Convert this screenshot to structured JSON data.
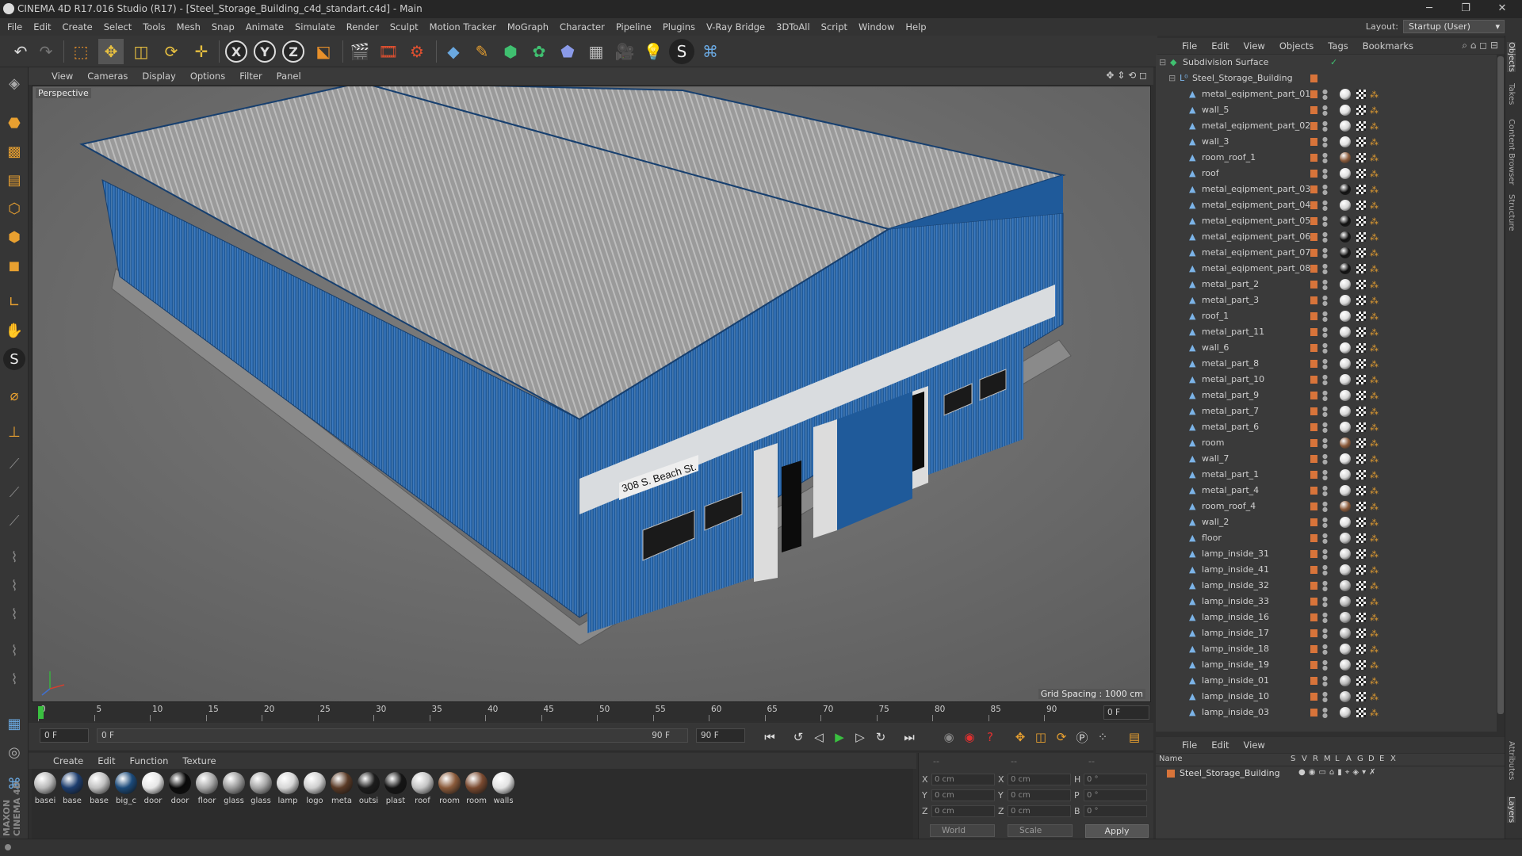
{
  "window": {
    "title": "CINEMA 4D R17.016 Studio (R17) - [Steel_Storage_Building_c4d_standart.c4d] - Main",
    "min": "─",
    "max": "❐",
    "close": "✕"
  },
  "menubar": [
    "File",
    "Edit",
    "Create",
    "Select",
    "Tools",
    "Mesh",
    "Snap",
    "Animate",
    "Simulate",
    "Render",
    "Sculpt",
    "Motion Tracker",
    "MoGraph",
    "Character",
    "Pipeline",
    "Plugins",
    "V-Ray Bridge",
    "3DToA​ll",
    "Script",
    "Window",
    "Help"
  ],
  "layout": {
    "label": "Layout:",
    "value": "Startup (User)"
  },
  "toolbar": {
    "x": "X",
    "y": "Y",
    "z": "Z"
  },
  "viewport": {
    "menu": [
      "View",
      "Cameras",
      "Display",
      "Options",
      "Filter",
      "Panel"
    ],
    "label": "Perspective",
    "grid_spacing": "Grid Spacing : 1000 cm",
    "sign_text": "308 S. Beach St."
  },
  "timeline": {
    "ticks": [
      "0",
      "5",
      "10",
      "15",
      "20",
      "25",
      "30",
      "35",
      "40",
      "45",
      "50",
      "55",
      "60",
      "65",
      "70",
      "75",
      "80",
      "85",
      "90"
    ],
    "end_frame": "0 F"
  },
  "transport": {
    "start": "0 F",
    "slider_start": "0 F",
    "slider_end": "90 F",
    "end": "90 F"
  },
  "materials": {
    "menu": [
      "Create",
      "Edit",
      "Function",
      "Texture"
    ],
    "items": [
      {
        "label": "basei",
        "color": "#b8b8b8"
      },
      {
        "label": "base",
        "color": "#1d3d6e"
      },
      {
        "label": "base",
        "color": "#c0c0c0"
      },
      {
        "label": "big_c",
        "color": "#1b4a7a"
      },
      {
        "label": "door",
        "color": "#e6e6e6"
      },
      {
        "label": "door",
        "color": "#0a0a0a"
      },
      {
        "label": "floor",
        "color": "#a8a8a8"
      },
      {
        "label": "glass",
        "color": "#9a9a9a"
      },
      {
        "label": "glass",
        "color": "#a5a5a5"
      },
      {
        "label": "lamp",
        "color": "#d6d6d6"
      },
      {
        "label": "logo",
        "color": "#cfcfcf"
      },
      {
        "label": "meta",
        "color": "#5a3a26"
      },
      {
        "label": "outsi",
        "color": "#1c1c1c"
      },
      {
        "label": "plast",
        "color": "#151515"
      },
      {
        "label": "roof",
        "color": "#c4c4c4"
      },
      {
        "label": "room",
        "color": "#8a5a3a"
      },
      {
        "label": "room",
        "color": "#7a4a30"
      },
      {
        "label": "walls",
        "color": "#e2e2e2"
      }
    ]
  },
  "coords": {
    "header": [
      "--",
      "--",
      "--"
    ],
    "rows": [
      {
        "a": "X",
        "av": "0 cm",
        "b": "X",
        "bv": "0 cm",
        "c": "H",
        "cv": "0 °"
      },
      {
        "a": "Y",
        "av": "0 cm",
        "b": "Y",
        "bv": "0 cm",
        "c": "P",
        "cv": "0 °"
      },
      {
        "a": "Z",
        "av": "0 cm",
        "b": "Z",
        "bv": "0 cm",
        "c": "B",
        "cv": "0 °"
      }
    ],
    "space": "World",
    "mode": "Scale",
    "apply": "Apply"
  },
  "object_manager": {
    "menu": [
      "File",
      "Edit",
      "View",
      "Objects",
      "Tags",
      "Bookmarks"
    ],
    "root": "Subdivision Surface",
    "group": "Steel_Storage_Building",
    "objects": [
      {
        "name": "metal_eqipment_part_01",
        "mat": "#e0e0e0"
      },
      {
        "name": "wall_5",
        "mat": "#e0e0e0"
      },
      {
        "name": "metal_eqipment_part_02",
        "mat": "#d8d8d8"
      },
      {
        "name": "wall_3",
        "mat": "#e0e0e0"
      },
      {
        "name": "room_roof_1",
        "mat": "#8a5a3a"
      },
      {
        "name": "roof",
        "mat": "#e0e0e0"
      },
      {
        "name": "metal_eqipment_part_03",
        "mat": "#111111"
      },
      {
        "name": "metal_eqipment_part_04",
        "mat": "#d8d8d8"
      },
      {
        "name": "metal_eqipment_part_05",
        "mat": "#111111"
      },
      {
        "name": "metal_eqipment_part_06",
        "mat": "#111111"
      },
      {
        "name": "metal_eqipment_part_07",
        "mat": "#111111"
      },
      {
        "name": "metal_eqipment_part_08",
        "mat": "#111111"
      },
      {
        "name": "metal_part_2",
        "mat": "#d8d8d8"
      },
      {
        "name": "metal_part_3",
        "mat": "#d8d8d8"
      },
      {
        "name": "roof_1",
        "mat": "#e0e0e0"
      },
      {
        "name": "metal_part_11",
        "mat": "#d8d8d8"
      },
      {
        "name": "wall_6",
        "mat": "#e0e0e0"
      },
      {
        "name": "metal_part_8",
        "mat": "#d8d8d8"
      },
      {
        "name": "metal_part_10",
        "mat": "#d8d8d8"
      },
      {
        "name": "metal_part_9",
        "mat": "#d8d8d8"
      },
      {
        "name": "metal_part_7",
        "mat": "#d8d8d8"
      },
      {
        "name": "metal_part_6",
        "mat": "#d8d8d8"
      },
      {
        "name": "room",
        "mat": "#8a5a3a"
      },
      {
        "name": "wall_7",
        "mat": "#e0e0e0"
      },
      {
        "name": "metal_part_1",
        "mat": "#d8d8d8"
      },
      {
        "name": "metal_part_4",
        "mat": "#d8d8d8"
      },
      {
        "name": "room_roof_4",
        "mat": "#8a5a3a"
      },
      {
        "name": "wall_2",
        "mat": "#e0e0e0"
      },
      {
        "name": "floor",
        "mat": "#c8c8c8"
      },
      {
        "name": "lamp_inside_31",
        "mat": "#d0d0d0"
      },
      {
        "name": "lamp_inside_41",
        "mat": "#d0d0d0"
      },
      {
        "name": "lamp_inside_32",
        "mat": "#b8b8b8"
      },
      {
        "name": "lamp_inside_33",
        "mat": "#b8b8b8"
      },
      {
        "name": "lamp_inside_16",
        "mat": "#b8b8b8"
      },
      {
        "name": "lamp_inside_17",
        "mat": "#b8b8b8"
      },
      {
        "name": "lamp_inside_18",
        "mat": "#d0d0d0"
      },
      {
        "name": "lamp_inside_19",
        "mat": "#d0d0d0"
      },
      {
        "name": "lamp_inside_01",
        "mat": "#b8b8b8"
      },
      {
        "name": "lamp_inside_10",
        "mat": "#b8b8b8"
      },
      {
        "name": "lamp_inside_03",
        "mat": "#d0d0d0"
      }
    ]
  },
  "layer_manager": {
    "menu": [
      "File",
      "Edit",
      "View"
    ],
    "columns": [
      "Name",
      "S",
      "V",
      "R",
      "M",
      "L",
      "A",
      "G",
      "D",
      "E",
      "X"
    ],
    "row": "Steel_Storage_Building"
  },
  "right_tabs": [
    "Objects",
    "Takes",
    "Content Browser",
    "Structure",
    "Attributes",
    "Layers"
  ],
  "brand": "MAXON CINEMA 4D"
}
